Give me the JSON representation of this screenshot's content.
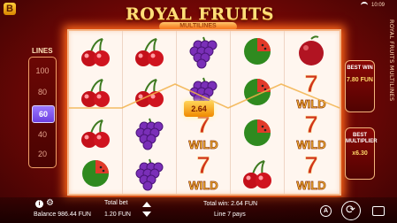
{
  "app_title": "ROYAL FRUITS MULTILINES",
  "header": {
    "title": "ROYAL FRUITS",
    "subtitle": "MULTILINES",
    "time": "10:09"
  },
  "lines": {
    "label": "LINES",
    "options": [
      "100",
      "80",
      "60",
      "40",
      "20"
    ],
    "selected": "60"
  },
  "best_win": {
    "label": "BEST WIN",
    "value": "7.80 FUN"
  },
  "best_multiplier": {
    "label": "BEST MULTIPLIER",
    "value": "x6.30"
  },
  "win_popup": "2.64",
  "reels": [
    [
      "cherry",
      "cherry",
      "cherry",
      "watermelon"
    ],
    [
      "cherry",
      "cherry",
      "grapes",
      "grapes"
    ],
    [
      "grapes",
      "grapes",
      "wild",
      "wild"
    ],
    [
      "watermelon",
      "watermelon",
      "watermelon",
      "cherry"
    ],
    [
      "plum",
      "wild",
      "wild",
      "wild"
    ]
  ],
  "symbols": {
    "wild_text": "WILD"
  },
  "footer": {
    "balance_label": "Balance",
    "balance_value": "986.44 FUN",
    "total_bet_label": "Total bet",
    "total_bet_value": "1.20 FUN",
    "total_win": "Total win: 2.64 FUN",
    "line_pays": "Line 7 pays",
    "auto_label": "A"
  },
  "colors": {
    "accent": "#ffd86a",
    "reel_bg": "#fff6ef",
    "selected": "#7a4ff0"
  }
}
